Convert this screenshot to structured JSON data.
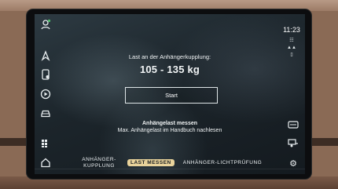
{
  "status": {
    "time": "11:23"
  },
  "main": {
    "title": "Last an der Anhängerkupplung:",
    "value": "105 - 135 kg",
    "start_button": "Start",
    "measure_title": "Anhängelast messen",
    "measure_note": "Max. Anhängelast im Handbuch nachlesen"
  },
  "tabs": [
    {
      "label_line1": "ANHÄNGER-",
      "label_line2": "KUPPLUNG",
      "active": false
    },
    {
      "label": "LAST MESSEN",
      "active": true
    },
    {
      "label": "ANHÄNGER-LICHTPRÜFUNG",
      "active": false
    }
  ],
  "icons": {
    "left": [
      "profile-icon",
      "navigation-icon",
      "phone-icon",
      "media-icon",
      "car-icon",
      "apps-grid-icon",
      "home-icon"
    ],
    "right": [
      "wifi-icon",
      "signal-icon",
      "battery-icon",
      "camera-icon",
      "settings-gear-icon"
    ]
  },
  "colors": {
    "active_tab": "#e9d39b"
  }
}
